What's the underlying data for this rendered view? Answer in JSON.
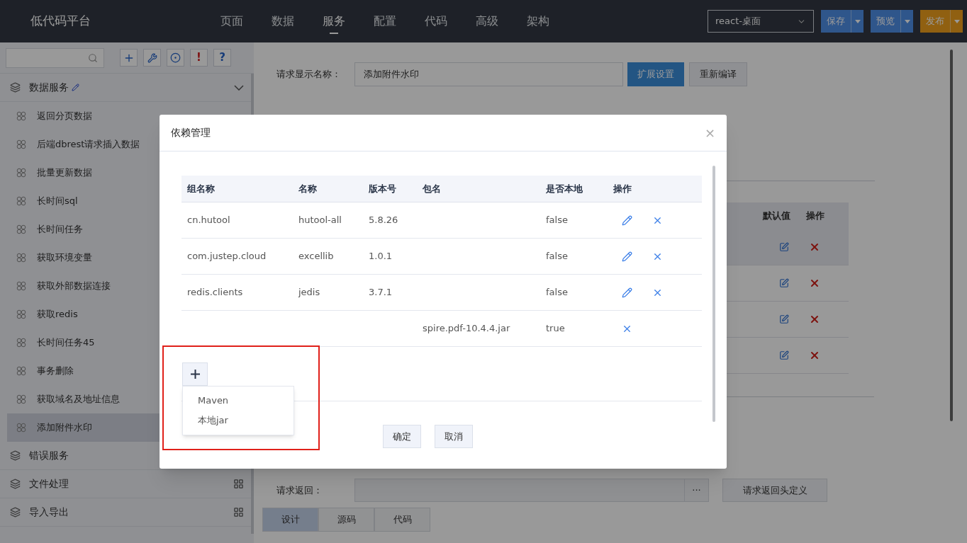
{
  "header": {
    "brand": "低代码平台",
    "nav": [
      {
        "label": "页面",
        "selected": false
      },
      {
        "label": "数据",
        "selected": false
      },
      {
        "label": "服务",
        "selected": true
      },
      {
        "label": "配置",
        "selected": false
      },
      {
        "label": "代码",
        "selected": false
      },
      {
        "label": "高级",
        "selected": false
      },
      {
        "label": "架构",
        "selected": false
      }
    ],
    "env_select": "react-桌面",
    "buttons": [
      {
        "label": "保存",
        "kind": "primary"
      },
      {
        "label": "预览",
        "kind": "primary"
      },
      {
        "label": "发布",
        "kind": "warning"
      }
    ]
  },
  "sidebar": {
    "tools": [
      {
        "kind": "add"
      },
      {
        "kind": "wrench"
      },
      {
        "kind": "target"
      },
      {
        "kind": "glyph",
        "glyph": "!"
      },
      {
        "kind": "glyph",
        "glyph": "?"
      }
    ],
    "groups": [
      {
        "label": "数据服务",
        "expanded": true,
        "children": [
          {
            "label": "返回分页数据",
            "selected": false
          },
          {
            "label": "后端dbrest请求插入数据",
            "selected": false
          },
          {
            "label": "批量更新数据",
            "selected": false
          },
          {
            "label": "长时间sql",
            "selected": false
          },
          {
            "label": "长时间任务",
            "selected": false
          },
          {
            "label": "获取环境变量",
            "selected": false
          },
          {
            "label": "获取外部数据连接",
            "selected": false
          },
          {
            "label": "获取redis",
            "selected": false
          },
          {
            "label": "长时间任务45",
            "selected": false
          },
          {
            "label": "事务删除",
            "selected": false
          },
          {
            "label": "获取域名及地址信息",
            "selected": false
          },
          {
            "label": "添加附件水印",
            "selected": true
          }
        ]
      },
      {
        "label": "错误服务",
        "expanded": false
      },
      {
        "label": "文件处理",
        "expanded": false
      },
      {
        "label": "导入导出",
        "expanded": false
      }
    ]
  },
  "main": {
    "display_name": {
      "label": "请求显示名称：",
      "value": "添加附件水印"
    },
    "buttons": [
      "扩展设置",
      "重新编译"
    ],
    "param_table": {
      "columns": [
        "默认值",
        "操作"
      ],
      "rows": [
        {
          "selected": true
        },
        {
          "selected": false
        },
        {
          "selected": false
        },
        {
          "selected": false
        }
      ]
    },
    "response": {
      "label": "请求返回：",
      "more": "···",
      "button": "请求返回头定义"
    },
    "tabs": [
      {
        "label": "设计",
        "selected": true
      },
      {
        "label": "源码",
        "selected": false
      },
      {
        "label": "代码",
        "selected": false
      }
    ]
  },
  "dialog": {
    "title": "依赖管理",
    "close": "×",
    "columns": [
      "组名称",
      "名称",
      "版本号",
      "包名",
      "是否本地",
      "操作"
    ],
    "rows": [
      {
        "group": "cn.hutool",
        "name": "hutool-all",
        "version": "5.8.26",
        "package": "",
        "local": "false",
        "editable": true
      },
      {
        "group": "com.justep.cloud",
        "name": "excellib",
        "version": "1.0.1",
        "package": "",
        "local": "false",
        "editable": true
      },
      {
        "group": "redis.clients",
        "name": "jedis",
        "version": "3.7.1",
        "package": "",
        "local": "false",
        "editable": true
      },
      {
        "group": "",
        "name": "",
        "version": "",
        "package": "spire.pdf-10.4.4.jar",
        "local": "true",
        "editable": false
      }
    ],
    "add_menu": [
      "Maven",
      "本地jar"
    ],
    "buttons": [
      "确定",
      "取消"
    ]
  }
}
